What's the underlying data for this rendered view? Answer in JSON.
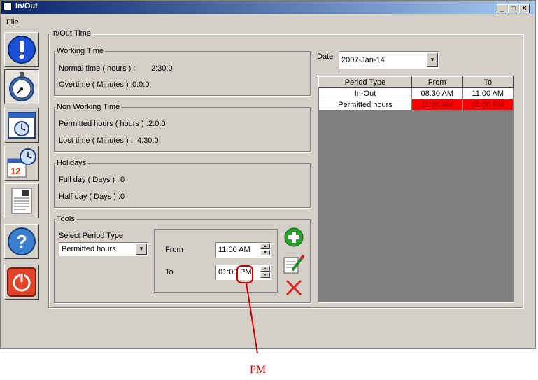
{
  "window": {
    "title": "In/Out"
  },
  "menu": {
    "file": "File"
  },
  "sidebar": {
    "items": [
      {
        "icon": "alert-icon"
      },
      {
        "icon": "stopwatch-icon"
      },
      {
        "icon": "clock-window-icon"
      },
      {
        "icon": "calendar-clock-icon"
      },
      {
        "icon": "report-icon"
      },
      {
        "icon": "help-icon"
      },
      {
        "icon": "power-icon"
      }
    ]
  },
  "main": {
    "group_title": "In/Out Time",
    "working_time": {
      "title": "Working Time",
      "normal_label": "Normal time ( hours ) :",
      "normal_value": "2:30:0",
      "overtime_label": "Overtime ( Minutes ) :",
      "overtime_value": "0:0:0"
    },
    "non_working_time": {
      "title": "Non Working Time",
      "permitted_label": "Permitted hours ( hours ) :",
      "permitted_value": "2:0:0",
      "lost_label": "Lost time ( Minutes ) :",
      "lost_value": "4:30:0"
    },
    "holidays": {
      "title": "Holidays",
      "full_label": "Full day ( Days ) :",
      "full_value": "0",
      "half_label": "Half day ( Days ) :",
      "half_value": "0"
    },
    "tools": {
      "title": "Tools",
      "period_type_label": "Select Period Type",
      "period_type_value": "Permitted hours",
      "from_label": "From",
      "from_value": "11:00 AM",
      "to_label": "To",
      "to_value_time": "01:00",
      "to_value_ampm": "PM"
    },
    "date": {
      "label": "Date",
      "value": "2007-Jan-14"
    },
    "grid": {
      "headers": [
        "Period Type",
        "From",
        "To"
      ],
      "rows": [
        {
          "type": "In-Out",
          "from": "08:30 AM",
          "to": "11:00 AM",
          "highlight": false
        },
        {
          "type": "Permitted hours",
          "from": "11:00 AM",
          "to": "01:00 PM",
          "highlight": true
        }
      ]
    }
  },
  "annotation": {
    "text": "PM",
    "color": "#cc0000"
  }
}
